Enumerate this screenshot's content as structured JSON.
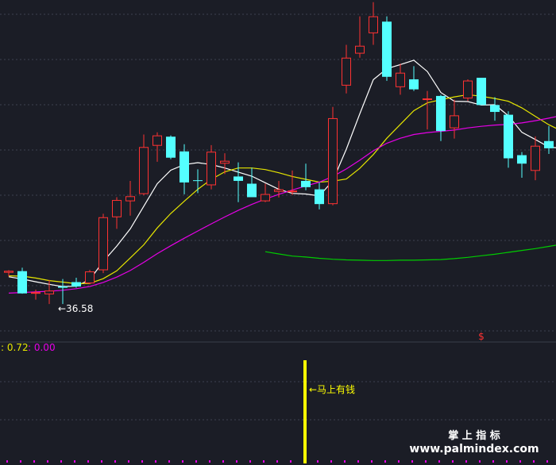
{
  "chart_data": {
    "type": "candlestick",
    "main_panel": {
      "grid": true,
      "candles": [
        {
          "o": 48.5,
          "h": 49.3,
          "l": 47.3,
          "c": 49.1,
          "color": "red"
        },
        {
          "o": 49.0,
          "h": 50.1,
          "l": 41.8,
          "c": 41.9,
          "color": "cyan"
        },
        {
          "o": 41.9,
          "h": 43.1,
          "l": 39.9,
          "c": 42.3,
          "color": "red"
        },
        {
          "o": 42.8,
          "h": 46.2,
          "l": 38.5,
          "c": 41.6,
          "color": "red"
        },
        {
          "o": 43.7,
          "h": 46.5,
          "l": 38.5,
          "c": 44.1,
          "color": "cyan"
        },
        {
          "o": 45.5,
          "h": 46.9,
          "l": 43.7,
          "c": 44.1,
          "color": "cyan"
        },
        {
          "o": 45.1,
          "h": 49.4,
          "l": 44.8,
          "c": 48.9,
          "color": "red"
        },
        {
          "o": 49.3,
          "h": 67.3,
          "l": 48.4,
          "c": 66.2,
          "color": "red"
        },
        {
          "o": 66.2,
          "h": 72.6,
          "l": 62.5,
          "c": 71.7,
          "color": "red"
        },
        {
          "o": 71.3,
          "h": 77.8,
          "l": 66.7,
          "c": 72.9,
          "color": "red"
        },
        {
          "o": 73.6,
          "h": 92.6,
          "l": 73.2,
          "c": 88.6,
          "color": "red"
        },
        {
          "o": 89.0,
          "h": 93.3,
          "l": 83.9,
          "c": 92.3,
          "color": "red"
        },
        {
          "o": 91.9,
          "h": 92.3,
          "l": 84.7,
          "c": 85.2,
          "color": "cyan"
        },
        {
          "o": 87.2,
          "h": 89.5,
          "l": 73.5,
          "c": 77.3,
          "color": "cyan"
        },
        {
          "o": 77.8,
          "h": 81.5,
          "l": 73.9,
          "c": 78.0,
          "color": "cyan"
        },
        {
          "o": 76.4,
          "h": 89.2,
          "l": 75.1,
          "c": 87.1,
          "color": "red"
        },
        {
          "o": 84.2,
          "h": 86.6,
          "l": 80.0,
          "c": 83.3,
          "color": "red"
        },
        {
          "o": 79.2,
          "h": 83.7,
          "l": 71.0,
          "c": 77.8,
          "color": "cyan"
        },
        {
          "o": 76.9,
          "h": 82.0,
          "l": 74.8,
          "c": 72.6,
          "color": "cyan"
        },
        {
          "o": 71.3,
          "h": 76.9,
          "l": 71.0,
          "c": 73.6,
          "color": "red"
        },
        {
          "o": 74.3,
          "h": 77.8,
          "l": 72.5,
          "c": 75.1,
          "color": "red"
        },
        {
          "o": 74.5,
          "h": 81.1,
          "l": 73.3,
          "c": 74.7,
          "color": "red"
        },
        {
          "o": 77.8,
          "h": 83.3,
          "l": 74.8,
          "c": 75.8,
          "color": "cyan"
        },
        {
          "o": 75.1,
          "h": 77.3,
          "l": 68.7,
          "c": 70.4,
          "color": "cyan"
        },
        {
          "o": 70.4,
          "h": 101.4,
          "l": 70.0,
          "c": 97.8,
          "color": "red"
        },
        {
          "o": 108.2,
          "h": 121.2,
          "l": 105.7,
          "c": 117.1,
          "color": "red"
        },
        {
          "o": 118.4,
          "h": 130.3,
          "l": 117.1,
          "c": 120.9,
          "color": "red"
        },
        {
          "o": 124.9,
          "h": 134.8,
          "l": 121.2,
          "c": 130.3,
          "color": "red"
        },
        {
          "o": 128.6,
          "h": 130.3,
          "l": 109.7,
          "c": 111.0,
          "color": "cyan"
        },
        {
          "o": 112.3,
          "h": 115.2,
          "l": 105.3,
          "c": 107.7,
          "color": "red"
        },
        {
          "o": 110.2,
          "h": 114.4,
          "l": 106.5,
          "c": 107.0,
          "color": "cyan"
        },
        {
          "o": 104.1,
          "h": 106.5,
          "l": 94.2,
          "c": 103.7,
          "color": "red"
        },
        {
          "o": 104.9,
          "h": 105.3,
          "l": 90.5,
          "c": 93.7,
          "color": "cyan"
        },
        {
          "o": 94.6,
          "h": 103.7,
          "l": 91.3,
          "c": 98.7,
          "color": "red"
        },
        {
          "o": 104.1,
          "h": 110.2,
          "l": 103.3,
          "c": 109.8,
          "color": "red"
        },
        {
          "o": 110.7,
          "h": 110.7,
          "l": 102.0,
          "c": 102.0,
          "color": "cyan"
        },
        {
          "o": 102.0,
          "h": 104.5,
          "l": 97.0,
          "c": 99.8,
          "color": "cyan"
        },
        {
          "o": 98.9,
          "h": 100.0,
          "l": 82.0,
          "c": 85.0,
          "color": "cyan"
        },
        {
          "o": 86.0,
          "h": 87.0,
          "l": 78.8,
          "c": 83.3,
          "color": "cyan"
        },
        {
          "o": 81.0,
          "h": 92.0,
          "l": 78.0,
          "c": 89.0,
          "color": "red"
        },
        {
          "o": 90.5,
          "h": 95.3,
          "l": 86.4,
          "c": 88.2,
          "color": "cyan"
        },
        {
          "o": 86.3,
          "h": 92.0,
          "l": 85.0,
          "c": 88.2,
          "color": "red"
        },
        {
          "o": 88.0,
          "h": 93.5,
          "l": 86.9,
          "c": 93.5,
          "color": "red"
        }
      ],
      "moving_averages": [
        {
          "color": "#ffffff",
          "values": [
            47.2,
            46.5,
            45.6,
            44.8,
            44.1,
            44.2,
            46.3,
            52.1,
            57.0,
            62.5,
            69.7,
            76.9,
            81.2,
            83.0,
            83.6,
            83.0,
            81.9,
            80.6,
            79.3,
            77.2,
            75.1,
            73.8,
            73.6,
            73.0,
            77.8,
            87.9,
            99.2,
            110.1,
            113.6,
            114.9,
            116.3,
            112.7,
            106.0,
            103.2,
            103.1,
            102.0,
            102.1,
            98.6,
            93.3,
            91.0,
            88.6,
            88.2,
            88.8
          ]
        },
        {
          "color": "#e6e600",
          "values": [
            47.5,
            47.4,
            46.8,
            46.0,
            45.5,
            45.0,
            45.1,
            46.6,
            49.1,
            53.2,
            57.4,
            62.8,
            67.4,
            71.3,
            75.1,
            78.3,
            80.7,
            81.9,
            81.9,
            81.4,
            80.4,
            79.2,
            78.3,
            77.4,
            77.7,
            78.4,
            81.8,
            86.2,
            91.4,
            95.8,
            100.2,
            102.7,
            103.7,
            104.6,
            105.3,
            104.8,
            104.1,
            103.2,
            101.1,
            98.4,
            95.7,
            93.6,
            92.6
          ]
        },
        {
          "color": "#e600e6",
          "values": [
            42.0,
            42.2,
            42.4,
            42.6,
            42.9,
            43.4,
            44.1,
            45.4,
            47.1,
            49.2,
            51.8,
            54.6,
            57.1,
            59.5,
            61.8,
            64.1,
            66.3,
            68.4,
            70.3,
            72.0,
            73.5,
            74.9,
            76.2,
            77.4,
            79.2,
            81.6,
            84.4,
            87.4,
            89.8,
            91.4,
            92.6,
            93.2,
            93.6,
            94.0,
            94.7,
            95.2,
            95.6,
            95.8,
            96.3,
            97.0,
            97.8,
            98.7,
            99.5
          ]
        },
        {
          "color": "#00cc00",
          "start_index": 19,
          "values": [
            55.2,
            54.5,
            53.8,
            53.5,
            53.1,
            52.8,
            52.6,
            52.5,
            52.4,
            52.4,
            52.5,
            52.5,
            52.6,
            52.7,
            53.0,
            53.4,
            53.9,
            54.4,
            55.0,
            55.6,
            56.2,
            56.9,
            57.6,
            58.4
          ]
        }
      ],
      "annotations": [
        {
          "text": "←36.58",
          "candle_index": 3
        },
        {
          "text": "$",
          "candle_index": 35
        }
      ]
    },
    "indicator_panel": {
      "legend": [
        {
          "text": ": 0.72",
          "color": "#e6e600"
        },
        {
          "text": " : 0.00",
          "color": "#e600e6"
        }
      ],
      "signal_bar": {
        "candle_index": 22,
        "color": "#ffff00"
      },
      "signal_label": {
        "text": "←马上有钱",
        "color": "#ffff00"
      }
    }
  },
  "watermark": {
    "line1": "掌 上 指 标",
    "line2": "www.palmindex.com"
  }
}
